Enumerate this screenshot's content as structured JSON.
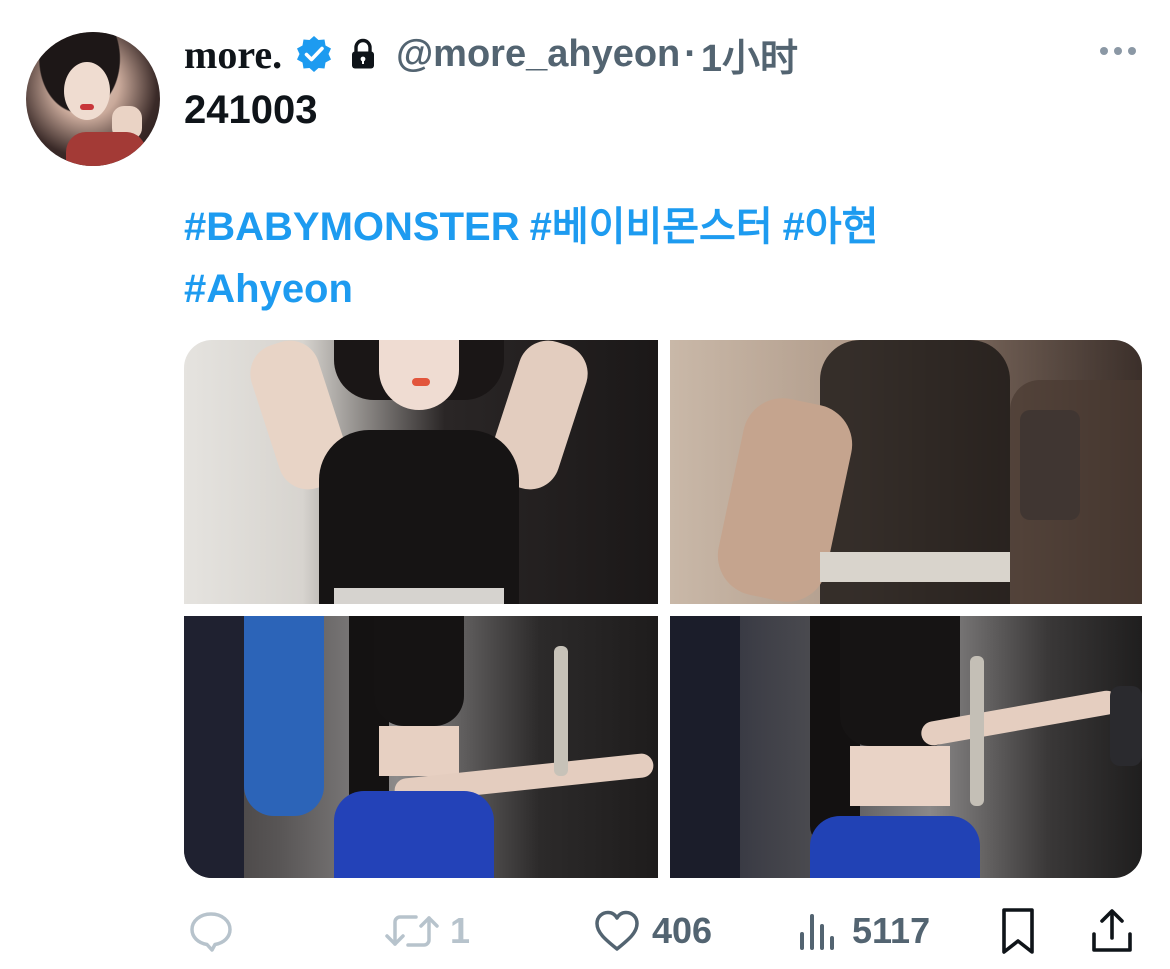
{
  "tweet": {
    "display_name": "more.",
    "handle": "@more_ahyeon",
    "separator": "·",
    "time": "1小时",
    "text": "241003",
    "hashtags": [
      "#BABYMONSTER",
      "#베이비몬스터",
      "#아현",
      "#Ahyeon"
    ]
  },
  "actions": {
    "reply_count": "",
    "retweet_count": "1",
    "like_count": "406",
    "view_count": "5117"
  },
  "colors": {
    "accent": "#1d9bf0",
    "text": "#0f1419",
    "secondary": "#536471",
    "muted": "#b7c3cc"
  },
  "icons": [
    "verified-badge-icon",
    "lock-icon",
    "more-icon",
    "reply-icon",
    "retweet-icon",
    "like-icon",
    "views-icon",
    "bookmark-icon",
    "share-icon"
  ]
}
